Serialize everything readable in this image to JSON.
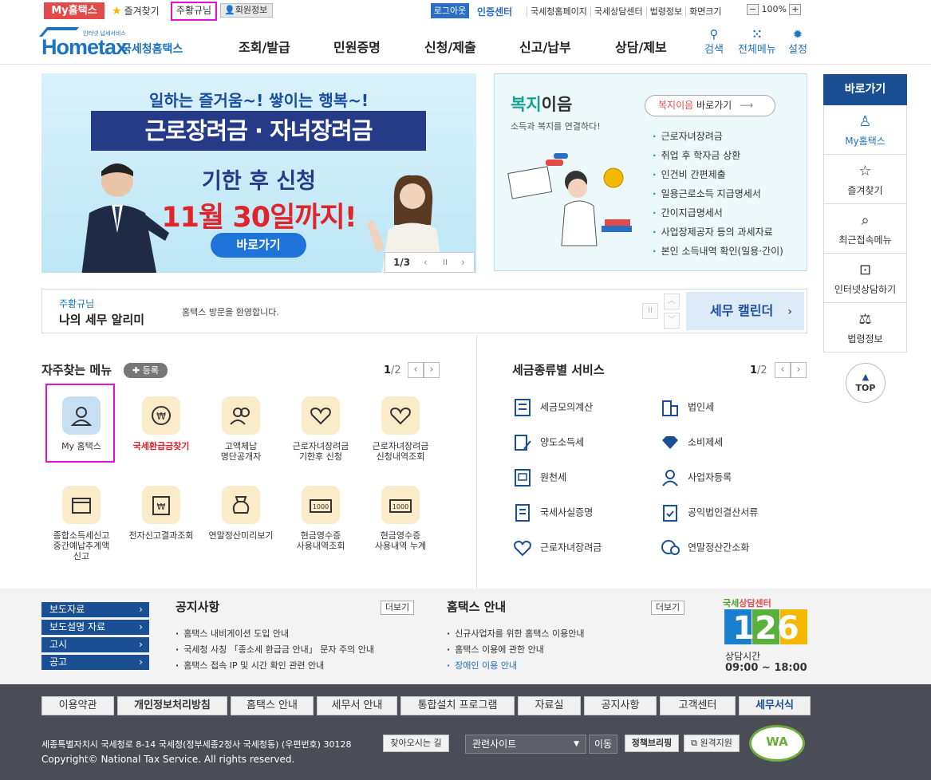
{
  "util": {
    "my_hometax": "My홈택스",
    "favorites": "즐겨찾기",
    "user_name": "주황규님",
    "member_info": "회원정보",
    "logout": "로그아웃",
    "cert_center": "인증센터",
    "links": [
      "국세청홈페이지",
      "국세상담센터",
      "법령정보",
      "화면크기"
    ],
    "zoom_minus": "−",
    "zoom_value": "100%",
    "zoom_plus": "+"
  },
  "logo": {
    "brand": "Hometax",
    "brand_sub": "국세청홈택스",
    "tagline": "인터넷 납세서비스"
  },
  "gnb": {
    "menu": [
      "조회/발급",
      "민원증명",
      "신청/제출",
      "신고/납부",
      "상담/제보"
    ],
    "search": "검색",
    "all_menu": "전체메뉴",
    "settings": "설정"
  },
  "banner": {
    "line1": "일하는 즐거움~! 쌓이는 행복~!",
    "line2": "근로장려금 · 자녀장려금",
    "line3": "기한 후 신청",
    "line4": "11월 30일까지!",
    "button": "바로가기",
    "page": "1/3",
    "prev": "‹",
    "pause": "II",
    "next": "›"
  },
  "welfare": {
    "title_em": "복지",
    "title_rest": "이음",
    "subtitle": "소득과 복지를 연결하다!",
    "shortcut_em": "복지이음",
    "shortcut_rest": " 바로가기",
    "items": [
      "근로자녀장려금",
      "취업 후 학자금 상환",
      "인건비 간편제출",
      "일용근로소득 지급명세서",
      "간이지급명세서",
      "사업장제공자 등의 과세자료",
      "본인 소득내역 확인(일용·간이)"
    ]
  },
  "notify": {
    "user": "주황규님",
    "title": "나의 세무 알리미",
    "message": "홈택스 방문을 환영합니다.",
    "tax_calendar": "세무 캘린더"
  },
  "frequent": {
    "title": "자주찾는 메뉴",
    "register": "등록",
    "page_current": "1",
    "page_total": "/2",
    "items": [
      {
        "label": "My 홈택스"
      },
      {
        "label": "국세환급금찾기"
      },
      {
        "label": "고액체납\n명단공개자"
      },
      {
        "label": "근로자녀장려금\n기한후 신청"
      },
      {
        "label": "근로자녀장려금\n신청내역조회"
      },
      {
        "label": "종합소득세신고\n중간예납추계액\n신고"
      },
      {
        "label": "전자신고결과조회"
      },
      {
        "label": "연말정산미리보기"
      },
      {
        "label": "현금영수증\n사용내역조회"
      },
      {
        "label": "현금영수증\n사용내역 누계"
      }
    ]
  },
  "tax_service": {
    "title": "세금종류별 서비스",
    "page_current": "1",
    "page_total": "/2",
    "left": [
      "세금모의계산",
      "양도소득세",
      "원천세",
      "국세사실증명",
      "근로자녀장려금"
    ],
    "right": [
      "법인세",
      "소비제세",
      "사업자등록",
      "공익법인결산서류",
      "연말정산간소화"
    ]
  },
  "quick": {
    "head": "바로가기",
    "items": [
      "My홈택스",
      "즐겨찾기",
      "최근접속메뉴",
      "인터넷상담하기",
      "법령정보"
    ],
    "top": "TOP"
  },
  "notices": {
    "side_links": [
      "보도자료",
      "보도설명 자료",
      "고시",
      "공고"
    ],
    "notice_title": "공지사항",
    "notice_more": "더보기",
    "notice_items": [
      "홈택스 내비게이션 도입 안내",
      "국세청 사칭 「종소세 환급금 안내」 문자 주의 안내",
      "홈택스 접속 IP 및 시간 확인 관련 안내"
    ],
    "guide_title": "홈택스 안내",
    "guide_more": "더보기",
    "guide_items": [
      "신규사업자를 위한 홈택스 이용안내",
      "홈택스 이용에 관한 안내",
      "장애인 이용 안내"
    ],
    "center_label_1": "국세",
    "center_label_2": "상담센터",
    "center_number": "126",
    "center_hours_label": "상담시간",
    "center_hours": "09:00 ~ 18:00"
  },
  "footer": {
    "nav": [
      "이용약관",
      "개인정보처리방침",
      "홈택스 안내",
      "세무서 안내",
      "통합설치 프로그램",
      "자료실",
      "공지사항",
      "고객센터",
      "세무서식"
    ],
    "address": "세종특별자치시 국세청로 8-14 국세청(정부세종2청사 국세청동) (우편번호) 30128",
    "directions": "찾아오시는 길",
    "copyright": "Copyright© National Tax Service. All rights reserved.",
    "related_sites": "관련사이트",
    "go": "이동",
    "policy_briefing": "정책브리핑",
    "remote_support": "원격지원",
    "wa_mark": "WA"
  },
  "colors": {
    "brand_blue": "#1e73be",
    "navy": "#1b4f94",
    "red": "#e34a4a",
    "highlight": "#e40fd2",
    "footer_bg": "#4a4d55"
  }
}
